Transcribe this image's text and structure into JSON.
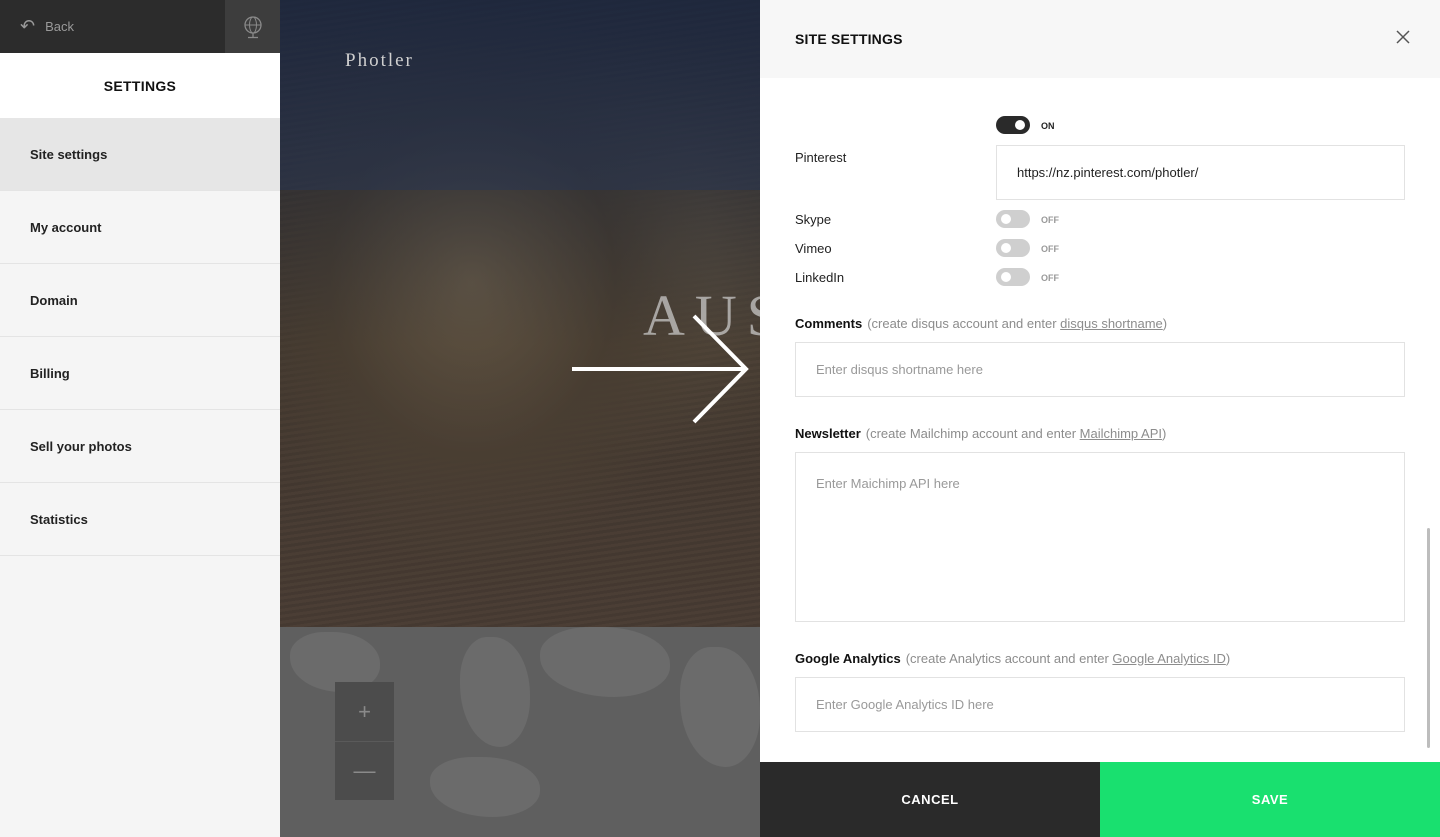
{
  "topbar": {
    "back_label": "Back"
  },
  "sidebar": {
    "title": "SETTINGS",
    "items": [
      {
        "label": "Site settings",
        "active": true
      },
      {
        "label": "My account"
      },
      {
        "label": "Domain"
      },
      {
        "label": "Billing"
      },
      {
        "label": "Sell your photos"
      },
      {
        "label": "Statistics"
      }
    ]
  },
  "preview": {
    "brand": "Photler",
    "headline": "AUS"
  },
  "panel": {
    "title": "SITE SETTINGS",
    "social": {
      "pinterest": {
        "label": "Pinterest",
        "state": "ON",
        "value": "https://nz.pinterest.com/photler/"
      },
      "skype": {
        "label": "Skype",
        "state": "OFF"
      },
      "vimeo": {
        "label": "Vimeo",
        "state": "OFF"
      },
      "linkedin": {
        "label": "LinkedIn",
        "state": "OFF"
      }
    },
    "comments": {
      "label": "Comments",
      "hint_pre": "(create disqus account and enter ",
      "hint_link": "disqus shortname",
      "hint_post": ")",
      "placeholder": "Enter disqus shortname here"
    },
    "newsletter": {
      "label": "Newsletter",
      "hint_pre": "(create Mailchimp account and enter ",
      "hint_link": "Mailchimp API",
      "hint_post": ")",
      "placeholder": "Enter Maichimp API here"
    },
    "analytics": {
      "label": "Google Analytics",
      "hint_pre": "(create Analytics account and enter ",
      "hint_link": "Google Analytics ID",
      "hint_post": ")",
      "placeholder": "Enter Google Analytics ID here"
    }
  },
  "footer": {
    "cancel_label": "CANCEL",
    "save_label": "SAVE"
  },
  "colors": {
    "save": "#19e06f",
    "dark": "#2a2a2a"
  }
}
